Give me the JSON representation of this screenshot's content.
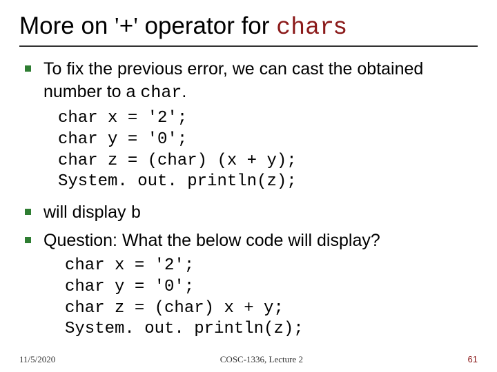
{
  "title": {
    "pre": "More on ",
    "lq": "'",
    "op": "+",
    "rq": "'",
    "mid": " operator for ",
    "code": "char",
    "suf": "s"
  },
  "b1": {
    "pre": "To fix the previous error, we can cast the obtained number to a ",
    "code": "char",
    "suf": "."
  },
  "code1": "char x = '2';\nchar y = '0';\nchar z = (char) (x + y);\nSystem. out. println(z);",
  "b2": {
    "pre": "will display ",
    "code": "b"
  },
  "b3": "Question: What the below code will display?",
  "code2": "char x = '2';\nchar y = '0';\nchar z = (char) x + y;\nSystem. out. println(z);",
  "footer": {
    "date": "11/5/2020",
    "center": "COSC-1336, Lecture 2",
    "page": "61"
  }
}
